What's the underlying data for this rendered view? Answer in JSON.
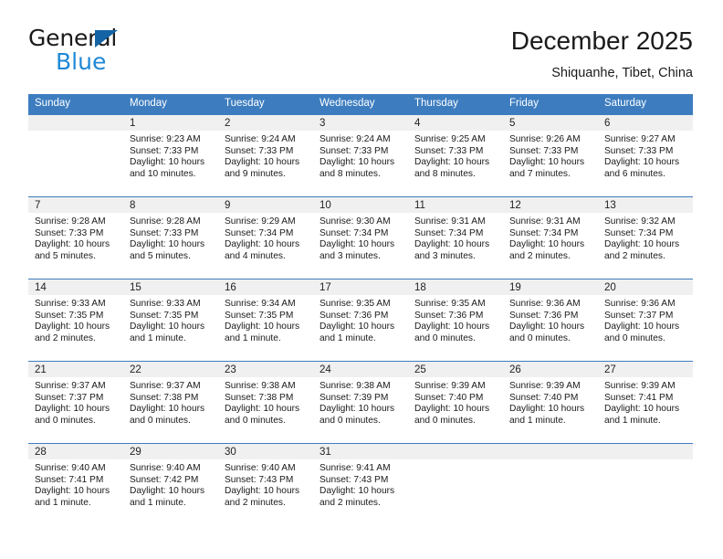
{
  "brand": {
    "name_top": "General",
    "name_bottom": "Blue",
    "accent_color": "#1f88d6",
    "triangle_color": "#1464a5"
  },
  "header": {
    "title": "December 2025",
    "subtitle": "Shiquanhe, Tibet, China"
  },
  "theme": {
    "header_row_bg": "#3d7dbf",
    "daynum_band_bg": "#f0f0f0",
    "grid_line": "#3d7dbf"
  },
  "weekdays": [
    "Sunday",
    "Monday",
    "Tuesday",
    "Wednesday",
    "Thursday",
    "Friday",
    "Saturday"
  ],
  "labels": {
    "sunrise_prefix": "Sunrise:",
    "sunset_prefix": "Sunset:",
    "daylight_prefix": "Daylight:"
  },
  "weeks": [
    [
      {
        "day": ""
      },
      {
        "day": "1",
        "sunrise": "Sunrise: 9:23 AM",
        "sunset": "Sunset: 7:33 PM",
        "daylight": "Daylight: 10 hours and 10 minutes."
      },
      {
        "day": "2",
        "sunrise": "Sunrise: 9:24 AM",
        "sunset": "Sunset: 7:33 PM",
        "daylight": "Daylight: 10 hours and 9 minutes."
      },
      {
        "day": "3",
        "sunrise": "Sunrise: 9:24 AM",
        "sunset": "Sunset: 7:33 PM",
        "daylight": "Daylight: 10 hours and 8 minutes."
      },
      {
        "day": "4",
        "sunrise": "Sunrise: 9:25 AM",
        "sunset": "Sunset: 7:33 PM",
        "daylight": "Daylight: 10 hours and 8 minutes."
      },
      {
        "day": "5",
        "sunrise": "Sunrise: 9:26 AM",
        "sunset": "Sunset: 7:33 PM",
        "daylight": "Daylight: 10 hours and 7 minutes."
      },
      {
        "day": "6",
        "sunrise": "Sunrise: 9:27 AM",
        "sunset": "Sunset: 7:33 PM",
        "daylight": "Daylight: 10 hours and 6 minutes."
      }
    ],
    [
      {
        "day": "7",
        "sunrise": "Sunrise: 9:28 AM",
        "sunset": "Sunset: 7:33 PM",
        "daylight": "Daylight: 10 hours and 5 minutes."
      },
      {
        "day": "8",
        "sunrise": "Sunrise: 9:28 AM",
        "sunset": "Sunset: 7:33 PM",
        "daylight": "Daylight: 10 hours and 5 minutes."
      },
      {
        "day": "9",
        "sunrise": "Sunrise: 9:29 AM",
        "sunset": "Sunset: 7:34 PM",
        "daylight": "Daylight: 10 hours and 4 minutes."
      },
      {
        "day": "10",
        "sunrise": "Sunrise: 9:30 AM",
        "sunset": "Sunset: 7:34 PM",
        "daylight": "Daylight: 10 hours and 3 minutes."
      },
      {
        "day": "11",
        "sunrise": "Sunrise: 9:31 AM",
        "sunset": "Sunset: 7:34 PM",
        "daylight": "Daylight: 10 hours and 3 minutes."
      },
      {
        "day": "12",
        "sunrise": "Sunrise: 9:31 AM",
        "sunset": "Sunset: 7:34 PM",
        "daylight": "Daylight: 10 hours and 2 minutes."
      },
      {
        "day": "13",
        "sunrise": "Sunrise: 9:32 AM",
        "sunset": "Sunset: 7:34 PM",
        "daylight": "Daylight: 10 hours and 2 minutes."
      }
    ],
    [
      {
        "day": "14",
        "sunrise": "Sunrise: 9:33 AM",
        "sunset": "Sunset: 7:35 PM",
        "daylight": "Daylight: 10 hours and 2 minutes."
      },
      {
        "day": "15",
        "sunrise": "Sunrise: 9:33 AM",
        "sunset": "Sunset: 7:35 PM",
        "daylight": "Daylight: 10 hours and 1 minute."
      },
      {
        "day": "16",
        "sunrise": "Sunrise: 9:34 AM",
        "sunset": "Sunset: 7:35 PM",
        "daylight": "Daylight: 10 hours and 1 minute."
      },
      {
        "day": "17",
        "sunrise": "Sunrise: 9:35 AM",
        "sunset": "Sunset: 7:36 PM",
        "daylight": "Daylight: 10 hours and 1 minute."
      },
      {
        "day": "18",
        "sunrise": "Sunrise: 9:35 AM",
        "sunset": "Sunset: 7:36 PM",
        "daylight": "Daylight: 10 hours and 0 minutes."
      },
      {
        "day": "19",
        "sunrise": "Sunrise: 9:36 AM",
        "sunset": "Sunset: 7:36 PM",
        "daylight": "Daylight: 10 hours and 0 minutes."
      },
      {
        "day": "20",
        "sunrise": "Sunrise: 9:36 AM",
        "sunset": "Sunset: 7:37 PM",
        "daylight": "Daylight: 10 hours and 0 minutes."
      }
    ],
    [
      {
        "day": "21",
        "sunrise": "Sunrise: 9:37 AM",
        "sunset": "Sunset: 7:37 PM",
        "daylight": "Daylight: 10 hours and 0 minutes."
      },
      {
        "day": "22",
        "sunrise": "Sunrise: 9:37 AM",
        "sunset": "Sunset: 7:38 PM",
        "daylight": "Daylight: 10 hours and 0 minutes."
      },
      {
        "day": "23",
        "sunrise": "Sunrise: 9:38 AM",
        "sunset": "Sunset: 7:38 PM",
        "daylight": "Daylight: 10 hours and 0 minutes."
      },
      {
        "day": "24",
        "sunrise": "Sunrise: 9:38 AM",
        "sunset": "Sunset: 7:39 PM",
        "daylight": "Daylight: 10 hours and 0 minutes."
      },
      {
        "day": "25",
        "sunrise": "Sunrise: 9:39 AM",
        "sunset": "Sunset: 7:40 PM",
        "daylight": "Daylight: 10 hours and 0 minutes."
      },
      {
        "day": "26",
        "sunrise": "Sunrise: 9:39 AM",
        "sunset": "Sunset: 7:40 PM",
        "daylight": "Daylight: 10 hours and 1 minute."
      },
      {
        "day": "27",
        "sunrise": "Sunrise: 9:39 AM",
        "sunset": "Sunset: 7:41 PM",
        "daylight": "Daylight: 10 hours and 1 minute."
      }
    ],
    [
      {
        "day": "28",
        "sunrise": "Sunrise: 9:40 AM",
        "sunset": "Sunset: 7:41 PM",
        "daylight": "Daylight: 10 hours and 1 minute."
      },
      {
        "day": "29",
        "sunrise": "Sunrise: 9:40 AM",
        "sunset": "Sunset: 7:42 PM",
        "daylight": "Daylight: 10 hours and 1 minute."
      },
      {
        "day": "30",
        "sunrise": "Sunrise: 9:40 AM",
        "sunset": "Sunset: 7:43 PM",
        "daylight": "Daylight: 10 hours and 2 minutes."
      },
      {
        "day": "31",
        "sunrise": "Sunrise: 9:41 AM",
        "sunset": "Sunset: 7:43 PM",
        "daylight": "Daylight: 10 hours and 2 minutes."
      },
      {
        "day": ""
      },
      {
        "day": ""
      },
      {
        "day": ""
      }
    ]
  ]
}
